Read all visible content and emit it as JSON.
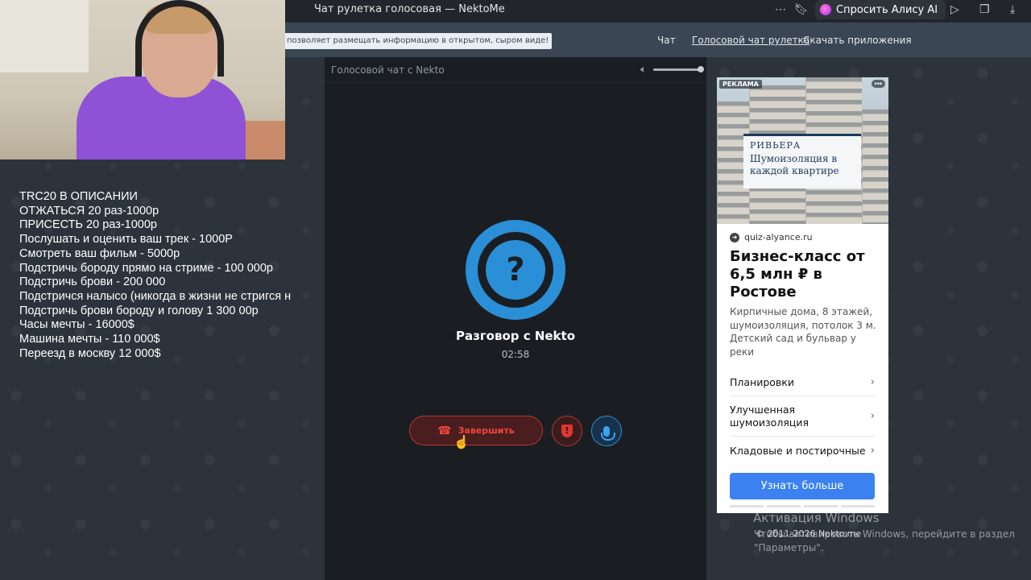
{
  "browser": {
    "tab_title": "Чат рулетка голосовая — NektoMe",
    "alisa_label": "Спросить Алису AI"
  },
  "site": {
    "notice": "позволяет размещать информацию в открытом, сыром виде!",
    "nav": [
      "Чат",
      "Голосовой чат рулетка",
      "Скачать приложения"
    ]
  },
  "donations": [
    "TRC20 В ОПИСАНИИ",
    "ОТЖАТЬСЯ 20 раз-1000р",
    "ПРИСЕСТЬ 20 раз-1000р",
    "Послушать и оценить ваш трек - 1000Р",
    "Смотреть ваш фильм - 5000р",
    "Подстричь бороду прямо на стриме - 100 000р",
    "Подстричь брови - 200 000",
    "Подстричся налысо (никогда в жизни не стригся н",
    "Подстричь брови бороду и голову 1 300 00р",
    "Часы мечты - 16000$",
    "Машина мечты - 110 000$",
    "Переезд в москву 12 000$"
  ],
  "call": {
    "panel_title": "Голосовой чат с Nekto",
    "volume_level": 1.0,
    "avatar_symbol": "?",
    "partner": "Разговор с Nekto",
    "timer": "02:58",
    "end_label": "Завершить",
    "report_symbol": "!"
  },
  "ad": {
    "label": "РЕКЛАМА",
    "sign_brand": "РИВЬЕРА",
    "sign_text": "Шумоизоляция в каждой квартире",
    "domain": "quiz-alyance.ru",
    "headline": "Бизнес-класс от 6,5 млн ₽ в Ростове",
    "description": "Кирпичные дома, 8 этажей, шумоизоляция, потолок 3 м. Детский сад и бульвар у реки",
    "links": [
      "Планировки",
      "Улучшенная шумоизоляция",
      "Кладовые и постирочные"
    ],
    "cta": "Узнать больше"
  },
  "watermark": {
    "title": "Активация Windows",
    "text": "Чтобы активировать Windows, перейдите в раздел \"Параметры\"."
  },
  "copyright": "© 2011-2026 Nekto.me"
}
